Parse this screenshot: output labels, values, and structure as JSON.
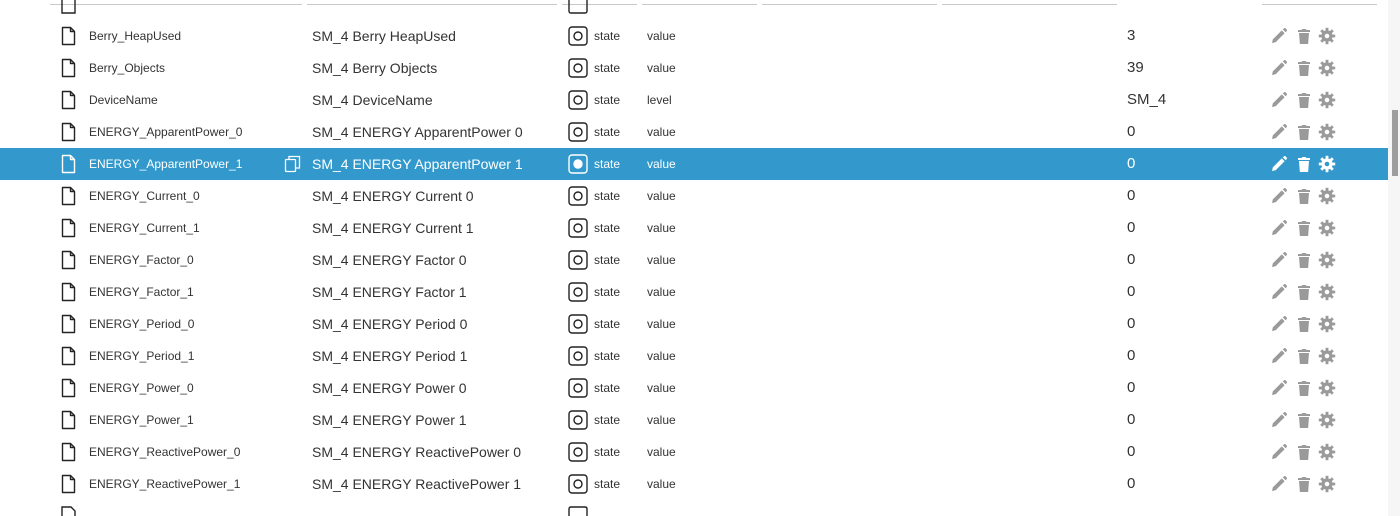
{
  "rows": [
    {
      "id": "Berry_HeapUsed",
      "name": "SM_4 Berry HeapUsed",
      "type": "state",
      "role": "value",
      "value": "3",
      "selected": false
    },
    {
      "id": "Berry_Objects",
      "name": "SM_4 Berry Objects",
      "type": "state",
      "role": "value",
      "value": "39",
      "selected": false
    },
    {
      "id": "DeviceName",
      "name": "SM_4 DeviceName",
      "type": "state",
      "role": "level",
      "value": "SM_4",
      "selected": false
    },
    {
      "id": "ENERGY_ApparentPower_0",
      "name": "SM_4 ENERGY ApparentPower 0",
      "type": "state",
      "role": "value",
      "value": "0",
      "selected": false
    },
    {
      "id": "ENERGY_ApparentPower_1",
      "name": "SM_4 ENERGY ApparentPower 1",
      "type": "state",
      "role": "value",
      "value": "0",
      "selected": true
    },
    {
      "id": "ENERGY_Current_0",
      "name": "SM_4 ENERGY Current 0",
      "type": "state",
      "role": "value",
      "value": "0",
      "selected": false
    },
    {
      "id": "ENERGY_Current_1",
      "name": "SM_4 ENERGY Current 1",
      "type": "state",
      "role": "value",
      "value": "0",
      "selected": false
    },
    {
      "id": "ENERGY_Factor_0",
      "name": "SM_4 ENERGY Factor 0",
      "type": "state",
      "role": "value",
      "value": "0",
      "selected": false
    },
    {
      "id": "ENERGY_Factor_1",
      "name": "SM_4 ENERGY Factor 1",
      "type": "state",
      "role": "value",
      "value": "0",
      "selected": false
    },
    {
      "id": "ENERGY_Period_0",
      "name": "SM_4 ENERGY Period 0",
      "type": "state",
      "role": "value",
      "value": "0",
      "selected": false
    },
    {
      "id": "ENERGY_Period_1",
      "name": "SM_4 ENERGY Period 1",
      "type": "state",
      "role": "value",
      "value": "0",
      "selected": false
    },
    {
      "id": "ENERGY_Power_0",
      "name": "SM_4 ENERGY Power 0",
      "type": "state",
      "role": "value",
      "value": "0",
      "selected": false
    },
    {
      "id": "ENERGY_Power_1",
      "name": "SM_4 ENERGY Power 1",
      "type": "state",
      "role": "value",
      "value": "0",
      "selected": false
    },
    {
      "id": "ENERGY_ReactivePower_0",
      "name": "SM_4 ENERGY ReactivePower 0",
      "type": "state",
      "role": "value",
      "value": "0",
      "selected": false
    },
    {
      "id": "ENERGY_ReactivePower_1",
      "name": "SM_4 ENERGY ReactivePower 1",
      "type": "state",
      "role": "value",
      "value": "0",
      "selected": false
    }
  ],
  "icons": {
    "file": "file-icon",
    "copy": "copy-icon",
    "state": "state-icon",
    "edit": "pencil-icon",
    "delete": "trash-icon",
    "settings": "gear-icon"
  },
  "colors": {
    "selected_row": "#3399cc",
    "action_icon": "#9a9a9a",
    "text": "#333333"
  }
}
